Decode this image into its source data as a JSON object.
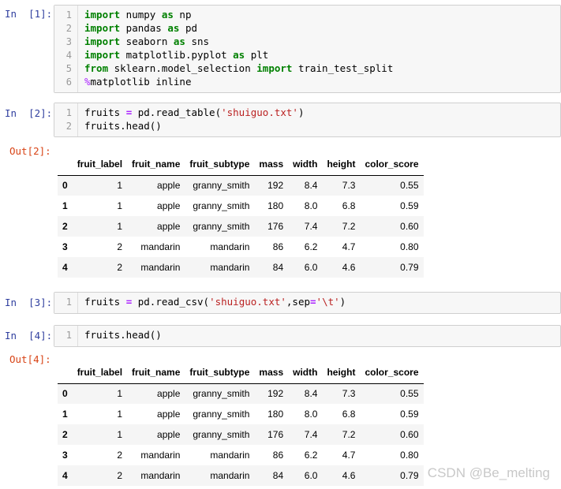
{
  "cells": [
    {
      "prompt": "In  [1]:",
      "lines": [
        [
          {
            "t": "import",
            "c": "kw"
          },
          {
            "t": " numpy "
          },
          {
            "t": "as",
            "c": "kw"
          },
          {
            "t": " np"
          }
        ],
        [
          {
            "t": "import",
            "c": "kw"
          },
          {
            "t": " pandas "
          },
          {
            "t": "as",
            "c": "kw"
          },
          {
            "t": " pd"
          }
        ],
        [
          {
            "t": "import",
            "c": "kw"
          },
          {
            "t": " seaborn "
          },
          {
            "t": "as",
            "c": "kw"
          },
          {
            "t": " sns"
          }
        ],
        [
          {
            "t": "import",
            "c": "kw"
          },
          {
            "t": " matplotlib.pyplot "
          },
          {
            "t": "as",
            "c": "kw"
          },
          {
            "t": " plt"
          }
        ],
        [
          {
            "t": "from",
            "c": "kw"
          },
          {
            "t": " sklearn.model_selection "
          },
          {
            "t": "import",
            "c": "kw"
          },
          {
            "t": " train_test_split"
          }
        ],
        [
          {
            "t": "%",
            "c": "magic"
          },
          {
            "t": "matplotlib inline"
          }
        ]
      ]
    },
    {
      "prompt": "In  [2]:",
      "lines": [
        [
          {
            "t": "fruits "
          },
          {
            "t": "=",
            "c": "op"
          },
          {
            "t": " pd.read_table("
          },
          {
            "t": "'shuiguo.txt'",
            "c": "str"
          },
          {
            "t": ")"
          }
        ],
        [
          {
            "t": "fruits.head()"
          }
        ]
      ]
    },
    {
      "prompt": "In  [3]:",
      "lines": [
        [
          {
            "t": "fruits "
          },
          {
            "t": "=",
            "c": "op"
          },
          {
            "t": " pd.read_csv("
          },
          {
            "t": "'shuiguo.txt'",
            "c": "str"
          },
          {
            "t": ",sep"
          },
          {
            "t": "=",
            "c": "op"
          },
          {
            "t": "'\\t'",
            "c": "str"
          },
          {
            "t": ")"
          }
        ]
      ]
    },
    {
      "prompt": "In  [4]:",
      "lines": [
        [
          {
            "t": "fruits.head()"
          }
        ]
      ]
    }
  ],
  "outputs": [
    {
      "prompt": "Out[2]:",
      "columns": [
        "",
        "fruit_label",
        "fruit_name",
        "fruit_subtype",
        "mass",
        "width",
        "height",
        "color_score"
      ],
      "rows": [
        [
          "0",
          "1",
          "apple",
          "granny_smith",
          "192",
          "8.4",
          "7.3",
          "0.55"
        ],
        [
          "1",
          "1",
          "apple",
          "granny_smith",
          "180",
          "8.0",
          "6.8",
          "0.59"
        ],
        [
          "2",
          "1",
          "apple",
          "granny_smith",
          "176",
          "7.4",
          "7.2",
          "0.60"
        ],
        [
          "3",
          "2",
          "mandarin",
          "mandarin",
          "86",
          "6.2",
          "4.7",
          "0.80"
        ],
        [
          "4",
          "2",
          "mandarin",
          "mandarin",
          "84",
          "6.0",
          "4.6",
          "0.79"
        ]
      ]
    },
    {
      "prompt": "Out[4]:",
      "columns": [
        "",
        "fruit_label",
        "fruit_name",
        "fruit_subtype",
        "mass",
        "width",
        "height",
        "color_score"
      ],
      "rows": [
        [
          "0",
          "1",
          "apple",
          "granny_smith",
          "192",
          "8.4",
          "7.3",
          "0.55"
        ],
        [
          "1",
          "1",
          "apple",
          "granny_smith",
          "180",
          "8.0",
          "6.8",
          "0.59"
        ],
        [
          "2",
          "1",
          "apple",
          "granny_smith",
          "176",
          "7.4",
          "7.2",
          "0.60"
        ],
        [
          "3",
          "2",
          "mandarin",
          "mandarin",
          "86",
          "6.2",
          "4.7",
          "0.80"
        ],
        [
          "4",
          "2",
          "mandarin",
          "mandarin",
          "84",
          "6.0",
          "4.6",
          "0.79"
        ]
      ]
    }
  ],
  "watermark": "CSDN @Be_melting"
}
